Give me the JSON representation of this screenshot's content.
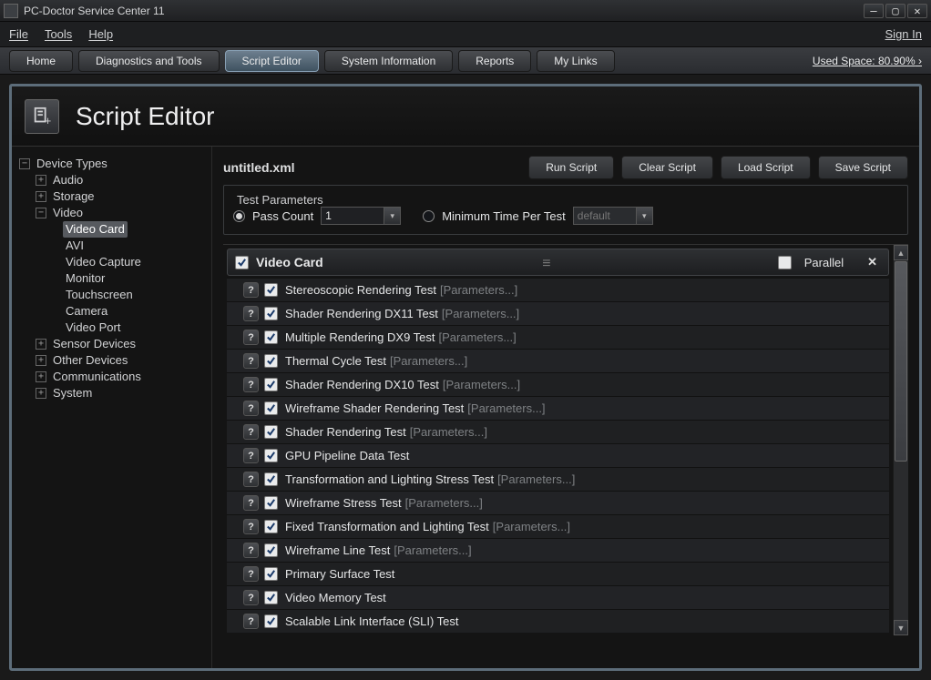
{
  "window": {
    "title": "PC-Doctor Service Center 11"
  },
  "menu": {
    "file": "File",
    "tools": "Tools",
    "help": "Help",
    "signin": "Sign In"
  },
  "toolbar": {
    "tabs": [
      {
        "label": "Home"
      },
      {
        "label": "Diagnostics and Tools"
      },
      {
        "label": "Script Editor",
        "active": true
      },
      {
        "label": "System Information"
      },
      {
        "label": "Reports"
      },
      {
        "label": "My Links"
      }
    ],
    "used_space": "Used Space: 80.90%"
  },
  "page": {
    "title": "Script Editor"
  },
  "tree": {
    "root": "Device Types",
    "nodes": {
      "audio": "Audio",
      "storage": "Storage",
      "video": "Video",
      "video_card": "Video Card",
      "avi": "AVI",
      "video_capture": "Video Capture",
      "monitor": "Monitor",
      "touchscreen": "Touchscreen",
      "camera": "Camera",
      "video_port": "Video Port",
      "sensor": "Sensor Devices",
      "other": "Other Devices",
      "comms": "Communications",
      "system": "System"
    }
  },
  "file": {
    "name": "untitled.xml"
  },
  "actions": {
    "run": "Run Script",
    "clear": "Clear Script",
    "load": "Load Script",
    "save": "Save Script"
  },
  "params": {
    "legend": "Test Parameters",
    "pass_count_label": "Pass Count",
    "pass_count_value": "1",
    "min_time_label": "Minimum Time Per Test",
    "min_time_value": "default"
  },
  "group": {
    "title": "Video Card",
    "parallel": "Parallel"
  },
  "param_link": "[Parameters...]",
  "tests": [
    {
      "name": "Stereoscopic Rendering Test",
      "params": true
    },
    {
      "name": "Shader Rendering DX11 Test",
      "params": true
    },
    {
      "name": "Multiple Rendering DX9 Test",
      "params": true
    },
    {
      "name": "Thermal Cycle Test",
      "params": true
    },
    {
      "name": "Shader Rendering DX10 Test",
      "params": true
    },
    {
      "name": "Wireframe Shader Rendering Test",
      "params": true
    },
    {
      "name": "Shader Rendering Test",
      "params": true
    },
    {
      "name": "GPU Pipeline Data Test",
      "params": false
    },
    {
      "name": "Transformation and Lighting Stress Test",
      "params": true
    },
    {
      "name": "Wireframe Stress Test",
      "params": true
    },
    {
      "name": "Fixed Transformation and Lighting Test",
      "params": true
    },
    {
      "name": "Wireframe Line Test",
      "params": true
    },
    {
      "name": "Primary Surface Test",
      "params": false
    },
    {
      "name": "Video Memory Test",
      "params": false
    },
    {
      "name": "Scalable Link Interface (SLI) Test",
      "params": false
    }
  ]
}
